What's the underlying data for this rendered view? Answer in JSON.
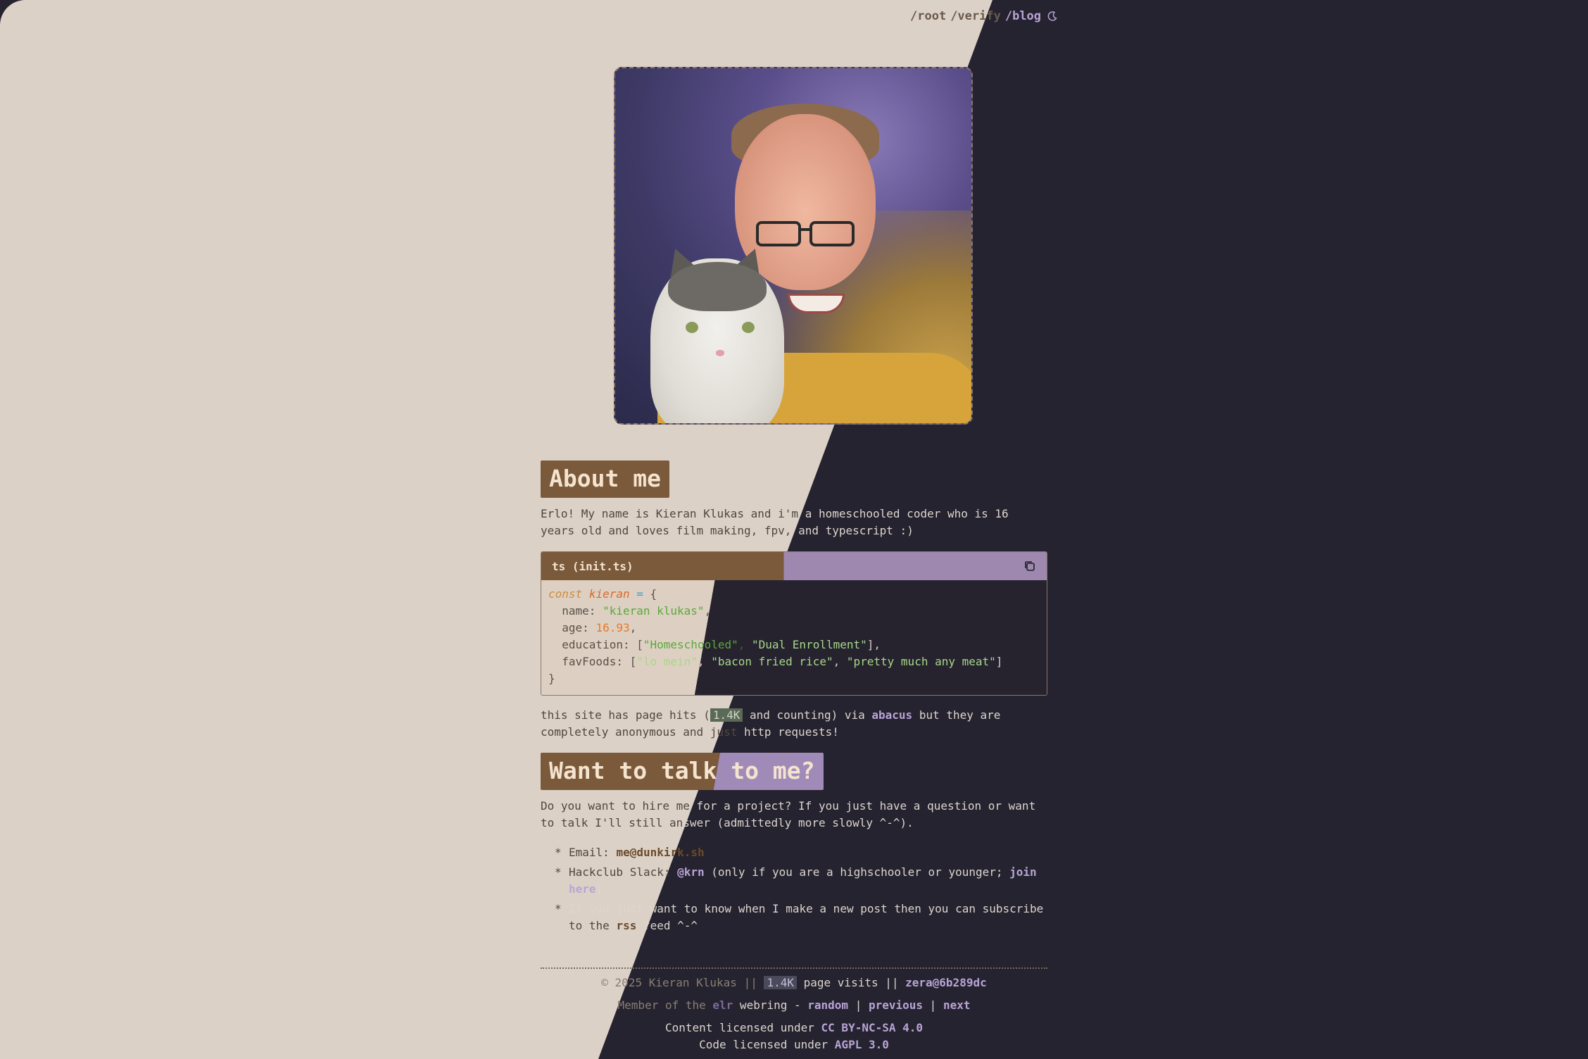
{
  "nav": {
    "root": "/root",
    "verify": "/verify",
    "blog": "/blog"
  },
  "about": {
    "heading": "About me",
    "intro_a": "Erlo! My name is Kieran Klukas and i'm",
    "intro_b": "a homeschooled coder who is 16",
    "intro_c": "years old and loves film making, fpv,",
    "intro_d": "and typescript :)"
  },
  "code": {
    "title": "ts (init.ts)",
    "line1": {
      "kw": "const",
      "var": "kieran",
      "op": "=",
      "brace": "{"
    },
    "line2": {
      "key": "name",
      "value": "\"kieran klukas\""
    },
    "line3": {
      "key": "age",
      "value": "16.93"
    },
    "line4": {
      "key": "education",
      "v1": "\"Homeschooled\"",
      "v2": "\"Dual Enrollment\""
    },
    "line5": {
      "key": "favFoods",
      "v1": "\"lo mein\"",
      "v2": "\"bacon fried rice\"",
      "v3": "\"pretty much any meat\""
    },
    "line6": "}"
  },
  "hits": {
    "pre": "this site has page hits (",
    "count": "1.4K",
    "mid": " and counting) via ",
    "link": "abacus",
    "post": " but they are",
    "line2a": "completely anonymous and just",
    "line2b": " http requests!"
  },
  "talk": {
    "heading_a": "Want to talk to me?",
    "p_a": "Do you want to hire me",
    "p_b": " for a project? If you just have a question or want",
    "p_c": "to talk I'll still an",
    "p_d": "swer (admittedly more slowly ^-^)."
  },
  "contacts": {
    "email_label": "Email: ",
    "email": "me@dunkirk.sh",
    "slack_label": "Hackclub Slack: ",
    "slack_handle": "@krn",
    "slack_note": " (only if you are a highschooler or younger; ",
    "slack_join": "join here",
    "slack_end": ")",
    "rss_a": "If you just want to know when I make a new post then you can subscribe",
    "rss_b": "to the ",
    "rss_link": "rss",
    "rss_c": " feed ^-^"
  },
  "footer": {
    "copyright": "© 2025 Kieran Klukas || ",
    "visits_count": "1.4K",
    "visits_label": " page visits || ",
    "commit": "zera@6b289dc",
    "member_pre": "Member of the ",
    "webring": "elr",
    "webring_mid": " webring - ",
    "random": "random",
    "sep1": " | ",
    "previous": "previous",
    "sep2": " | ",
    "next": "next",
    "content_license_pre": "Content licensed under ",
    "content_license": "CC BY-NC-SA 4.0",
    "code_license_pre": "Code licensed under ",
    "code_license": "AGPL 3.0"
  },
  "colors": {
    "light_bg": "#dcd1c7",
    "dark_bg": "#25232f",
    "accent_brown": "#7a5a3a",
    "accent_purple": "#b9a4d6"
  }
}
